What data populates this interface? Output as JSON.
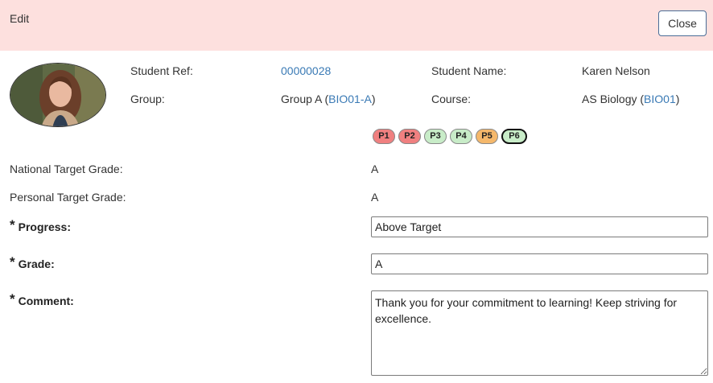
{
  "header": {
    "title": "Edit",
    "close_label": "Close"
  },
  "student": {
    "ref_label": "Student Ref:",
    "ref_value": "00000028",
    "name_label": "Student Name:",
    "name_value": "Karen Nelson",
    "group_label": "Group:",
    "group_prefix": "Group A (",
    "group_link": "BIO01-A",
    "group_suffix": ")",
    "course_label": "Course:",
    "course_prefix": "AS Biology (",
    "course_link": "BIO01",
    "course_suffix": ")"
  },
  "periods": [
    {
      "label": "P1",
      "color": "#f08080",
      "selected": false
    },
    {
      "label": "P2",
      "color": "#f08080",
      "selected": false
    },
    {
      "label": "P3",
      "color": "#c8ecc8",
      "selected": false
    },
    {
      "label": "P4",
      "color": "#c8ecc8",
      "selected": false
    },
    {
      "label": "P5",
      "color": "#f5b86b",
      "selected": false
    },
    {
      "label": "P6",
      "color": "#c8ecc8",
      "selected": true
    }
  ],
  "grades": {
    "national_label": "National Target Grade:",
    "national_value": "A",
    "personal_label": "Personal Target Grade:",
    "personal_value": "A"
  },
  "form": {
    "required_mark": "*",
    "progress_label": "Progress:",
    "progress_value": "Above Target",
    "grade_label": "Grade:",
    "grade_value": "A",
    "comment_label": "Comment:",
    "comment_value": "Thank you for your commitment to learning! Keep striving for excellence."
  },
  "colors": {
    "header_bg": "#fde0de",
    "link": "#3a7ab5",
    "button_border": "#4a6d97"
  }
}
